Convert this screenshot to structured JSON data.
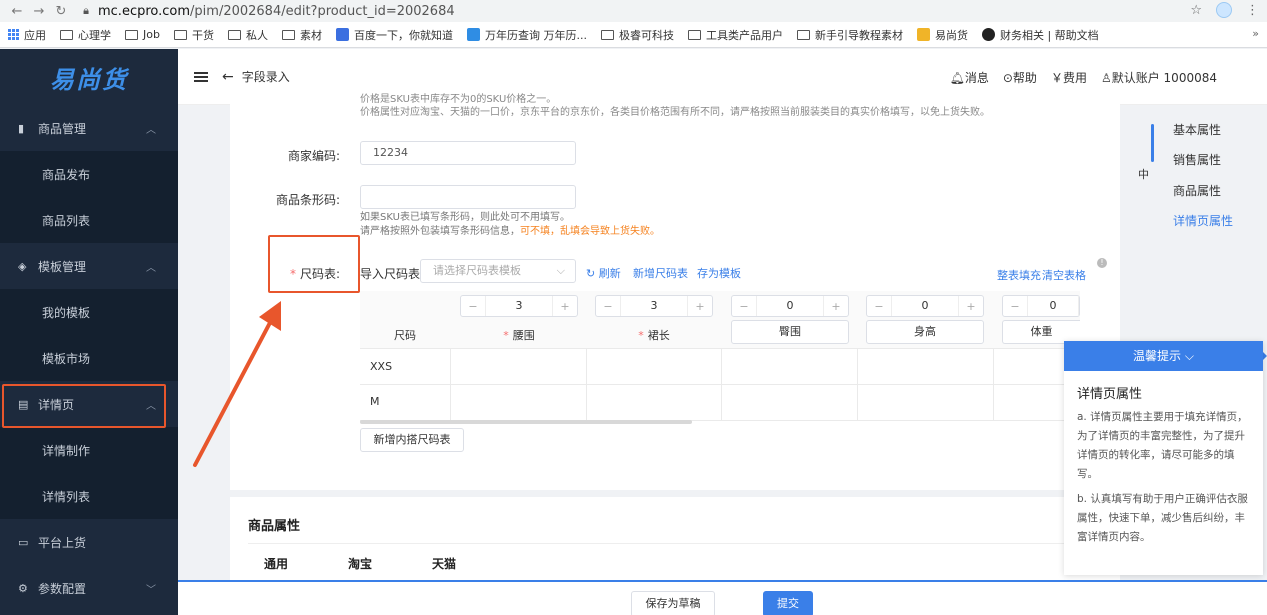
{
  "browser": {
    "url_host": "mc.ecpro.com",
    "url_path": "/pim/2002684/edit?product_id=2002684"
  },
  "bookmarks": [
    {
      "label": "应用",
      "icon": "apps-icon"
    },
    {
      "label": "心理学",
      "icon": "folder-icon"
    },
    {
      "label": "Job",
      "icon": "folder-icon"
    },
    {
      "label": "干货",
      "icon": "folder-icon"
    },
    {
      "label": "私人",
      "icon": "folder-icon"
    },
    {
      "label": "素材",
      "icon": "folder-icon"
    },
    {
      "label": "百度一下，你就知道",
      "icon": "baidu-icon"
    },
    {
      "label": "万年历查询 万年历...",
      "icon": "calendar-icon"
    },
    {
      "label": "极睿可科技",
      "icon": "folder-icon"
    },
    {
      "label": "工具类产品用户",
      "icon": "folder-icon"
    },
    {
      "label": "新手引导教程素材",
      "icon": "folder-icon"
    },
    {
      "label": "易尚货",
      "icon": "yishanghuo-icon"
    },
    {
      "label": "财务相关 | 帮助文档",
      "icon": "globe-icon"
    }
  ],
  "sidebar": {
    "logo": "易尚货",
    "groups": [
      {
        "label": "商品管理",
        "icon": "bar-chart-icon"
      },
      {
        "label": "模板管理",
        "icon": "layers-icon"
      },
      {
        "label": "详情页",
        "icon": "file-icon"
      },
      {
        "label": "平台上货",
        "icon": "upload-icon"
      },
      {
        "label": "参数配置",
        "icon": "settings-icon"
      }
    ],
    "subs": {
      "goods_publish": "商品发布",
      "goods_list": "商品列表",
      "my_templates": "我的模板",
      "template_market": "模板市场",
      "detail_make": "详情制作",
      "detail_list": "详情列表"
    }
  },
  "topbar": {
    "breadcrumb": "字段录入",
    "message": "消息",
    "help": "帮助",
    "fee": "费用",
    "account": "默认账户 1000084"
  },
  "form": {
    "note_price_1": "价格是SKU表中库存不为0的SKU价格之一。",
    "note_price_2": "价格属性对应淘宝、天猫的一口价，京东平台的京东价，各类目价格范围有所不同，请严格按照当前服装类目的真实价格填写，以免上货失败。",
    "merchant_code_label": "商家编码:",
    "merchant_code_value": "12234",
    "barcode_label": "商品条形码:",
    "barcode_note_1": "如果SKU表已填写条形码，则此处可不用填写。",
    "barcode_note_2a": "请严格按照外包装填写条形码信息，",
    "barcode_note_2b": "可不填，乱填会导致上货失败。",
    "size_label": "尺码表:",
    "import_size": "导入尺码表",
    "size_select_placeholder": "请选择尺码表模板",
    "refresh": "刷新",
    "new_size": "新增尺码表",
    "save_template": "存为模板",
    "fill_all": "整表填充",
    "clear_table": "清空表格"
  },
  "size_table": {
    "steppers": [
      "3",
      "3",
      "0",
      "0",
      "0"
    ],
    "headers": [
      "尺码",
      "腰围",
      "裙长",
      "臀围",
      "身高",
      "体重"
    ],
    "required_headers": [
      false,
      true,
      true,
      false,
      false,
      false
    ],
    "rows": [
      "XXS",
      "M"
    ],
    "add_button": "新增内搭尺码表"
  },
  "section": {
    "title": "商品属性",
    "tabs": [
      "通用",
      "淘宝",
      "天猫"
    ]
  },
  "right_nav": {
    "items": [
      "基本属性",
      "销售属性",
      "商品属性",
      "详情页属性"
    ],
    "active_index": 3,
    "zh_marker": "中"
  },
  "tip": {
    "header": "温馨提示",
    "title": "详情页属性",
    "p1": "a. 详情页属性主要用于填充详情页，为了详情页的丰富完整性，为了提升详情页的转化率，请尽可能多的填写。",
    "p2": "b. 认真填写有助于用户正确评估衣服属性，快速下单，减少售后纠纷，丰富详情页内容。"
  },
  "footer": {
    "save_draft": "保存为草稿",
    "submit": "提交"
  },
  "colors": {
    "accent": "#3a7fe8",
    "highlight": "#e8562c",
    "sidebar_bg": "#1d2a3d"
  }
}
